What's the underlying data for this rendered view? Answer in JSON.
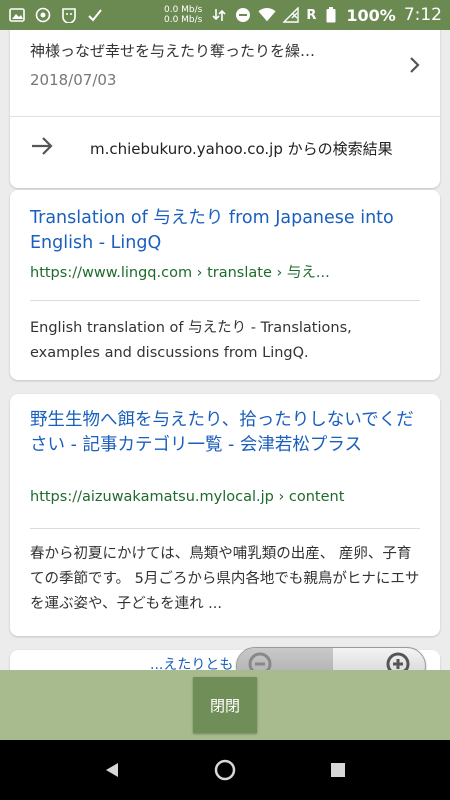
{
  "status_bar": {
    "net_up": "0.0 Mb/s",
    "net_down": "0.0 Mb/s",
    "roaming": "R",
    "battery": "100%",
    "time": "7:12"
  },
  "card_qa": {
    "title": "神様っなぜ幸せを与えたり奪ったりを繰…",
    "date": "2018/07/03",
    "more_results": "m.chiebukuro.yahoo.co.jp からの検索結果"
  },
  "result_1": {
    "title": "Translation of 与えたり from Japanese into English - LingQ",
    "url": "https://www.lingq.com › translate › 与え...",
    "snippet": "English translation of 与えたり - Translations, examples and discussions from LingQ."
  },
  "result_2": {
    "title": "野生生物へ餌を与えたり、拾ったりしないでください - 記事カテゴリ一覧 - 会津若松プラス",
    "url": "https://aizuwakamatsu.mylocal.jp › content",
    "snippet": "春から初夏にかけては、鳥類や哺乳類の出産、 産卵、子育ての季節です。 5月ごろから県内各地でも親鳥がヒナにエサを運ぶ姿や、子どもを連れ ..."
  },
  "result_3_peek": "...えたりとも【...",
  "close_label": "閉閉",
  "colors": {
    "status_bar": "#6b8a52",
    "action_bar": "#a7bb8e",
    "close_button": "#6f8e58",
    "link": "#1a5fbd",
    "url": "#1e6b2b"
  }
}
